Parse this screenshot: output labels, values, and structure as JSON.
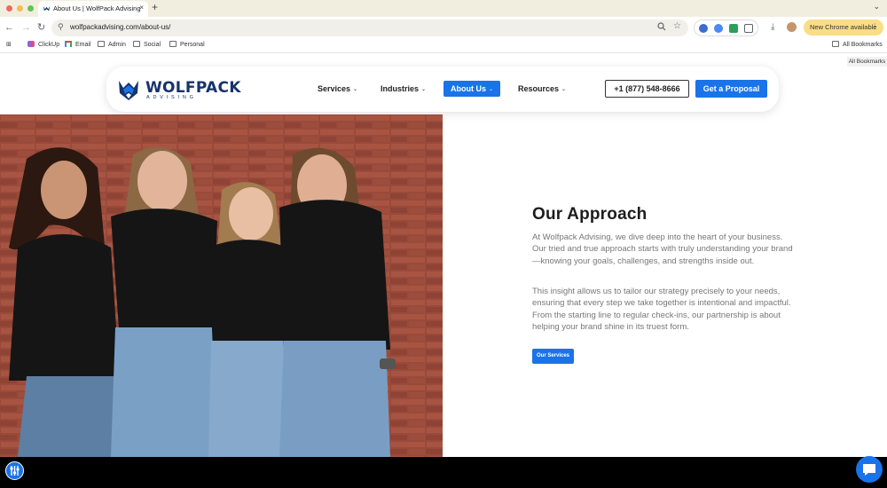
{
  "browser": {
    "tab": {
      "title": "About Us | WolfPack Advising",
      "close": "×"
    },
    "new_tab": "+",
    "tab_menu": "⌄",
    "url": "wolfpackadvising.com/about-us/",
    "update_label": "New Chrome available",
    "update_menu": "⋮",
    "nav": {
      "back": "←",
      "forward": "→",
      "reload": "↻"
    },
    "bookmarks": [
      {
        "label": "ClickUp",
        "icon": "clickup-icon"
      },
      {
        "label": "Email",
        "icon": "gmail-icon"
      },
      {
        "label": "Admin",
        "icon": "folder-icon"
      },
      {
        "label": "Social",
        "icon": "folder-icon"
      },
      {
        "label": "Personal",
        "icon": "folder-icon"
      }
    ],
    "all_bookmarks": "All Bookmarks",
    "all_bookmarks_tooltip": "All Bookmarks"
  },
  "site": {
    "logo_word": "WOLFPACK",
    "logo_sub": "ADVISING",
    "nav": [
      {
        "label": "Services",
        "chevron": "⌄"
      },
      {
        "label": "Industries",
        "chevron": "⌄"
      },
      {
        "label": "About Us",
        "chevron": "⌄",
        "active": true
      },
      {
        "label": "Resources",
        "chevron": "⌄"
      }
    ],
    "phone": "+1 (877) 548-8666",
    "cta": "Get a Proposal",
    "brand_color": "#1a73e8",
    "navy": "#16336b"
  },
  "approach": {
    "title": "Our Approach",
    "paragraph_1": "At Wolfpack Advising, we dive deep into the heart of your business. Our tried and true approach starts with truly understanding your brand—knowing your goals, challenges, and strengths inside out.",
    "paragraph_2": "This insight allows us to tailor our strategy precisely to your needs, ensuring that every step we take together is intentional and impactful. From the starting line to regular check-ins, our partnership is about helping your brand shine in its truest form.",
    "button": "Our Services"
  }
}
